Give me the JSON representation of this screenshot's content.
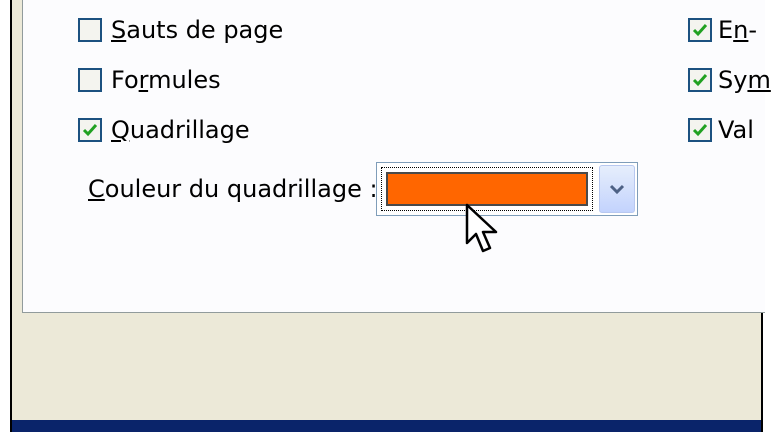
{
  "options_left": [
    {
      "label_pre": "",
      "label_mnemonic": "S",
      "label_post": "auts de page",
      "checked": false
    },
    {
      "label_pre": "Fo",
      "label_mnemonic": "r",
      "label_post": "mules",
      "checked": false
    },
    {
      "label_pre": "",
      "label_mnemonic": "Q",
      "label_post": "uadrillage",
      "checked": true
    }
  ],
  "options_right": [
    {
      "label_pre": "E",
      "label_mnemonic": "n",
      "label_post": "-",
      "checked": true
    },
    {
      "label_pre": "Sy",
      "label_mnemonic": "m",
      "label_post": "",
      "checked": true
    },
    {
      "label_pre": "Val",
      "label_mnemonic": "",
      "label_post": "",
      "checked": true
    }
  ],
  "gridline_color": {
    "label_mnemonic": "C",
    "label_rest": "ouleur du quadrillage :",
    "selected_color": "#ff6600"
  },
  "icons": {
    "checkmark": "checkmark-icon",
    "dropdown": "chevron-down-icon",
    "cursor": "mouse-pointer-icon"
  }
}
